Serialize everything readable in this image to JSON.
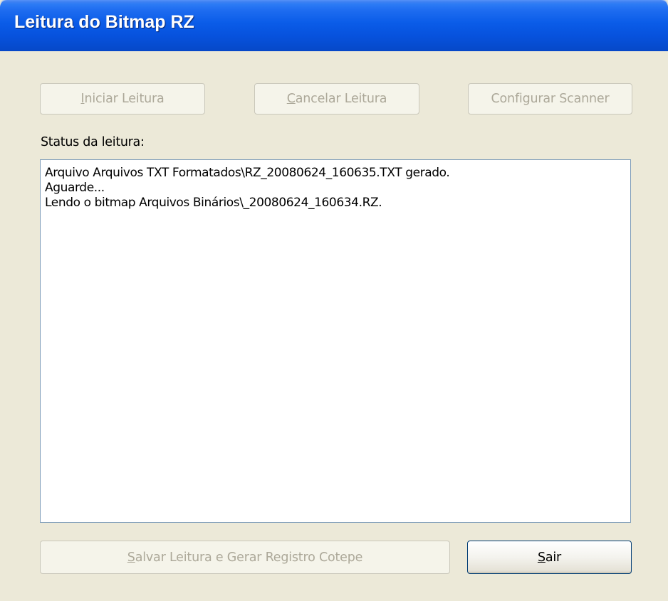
{
  "window": {
    "title": "Leitura do Bitmap RZ"
  },
  "toolbar": {
    "iniciar": {
      "mnemonic": "I",
      "rest": "niciar Leitura",
      "enabled": false
    },
    "cancelar": {
      "mnemonic": "C",
      "rest": "ancelar Leitura",
      "enabled": false
    },
    "configurar": {
      "label": "Configurar Scanner",
      "enabled": false
    }
  },
  "status": {
    "label": "Status da leitura:",
    "lines": [
      "Arquivo Arquivos TXT Formatados\\RZ_20080624_160635.TXT gerado.",
      "Aguarde...",
      "Lendo o bitmap Arquivos Binários\\_20080624_160634.RZ."
    ]
  },
  "footer": {
    "salvar": {
      "mnemonic": "S",
      "rest": "alvar Leitura e Gerar Registro Cotepe",
      "enabled": false
    },
    "sair": {
      "mnemonic": "S",
      "rest": "air",
      "enabled": true
    }
  },
  "colors": {
    "titlebar": "#0A5CE8",
    "dialog_bg": "#ECE9D8",
    "disabled_text": "#ACA899",
    "default_button_border": "#003C74"
  }
}
